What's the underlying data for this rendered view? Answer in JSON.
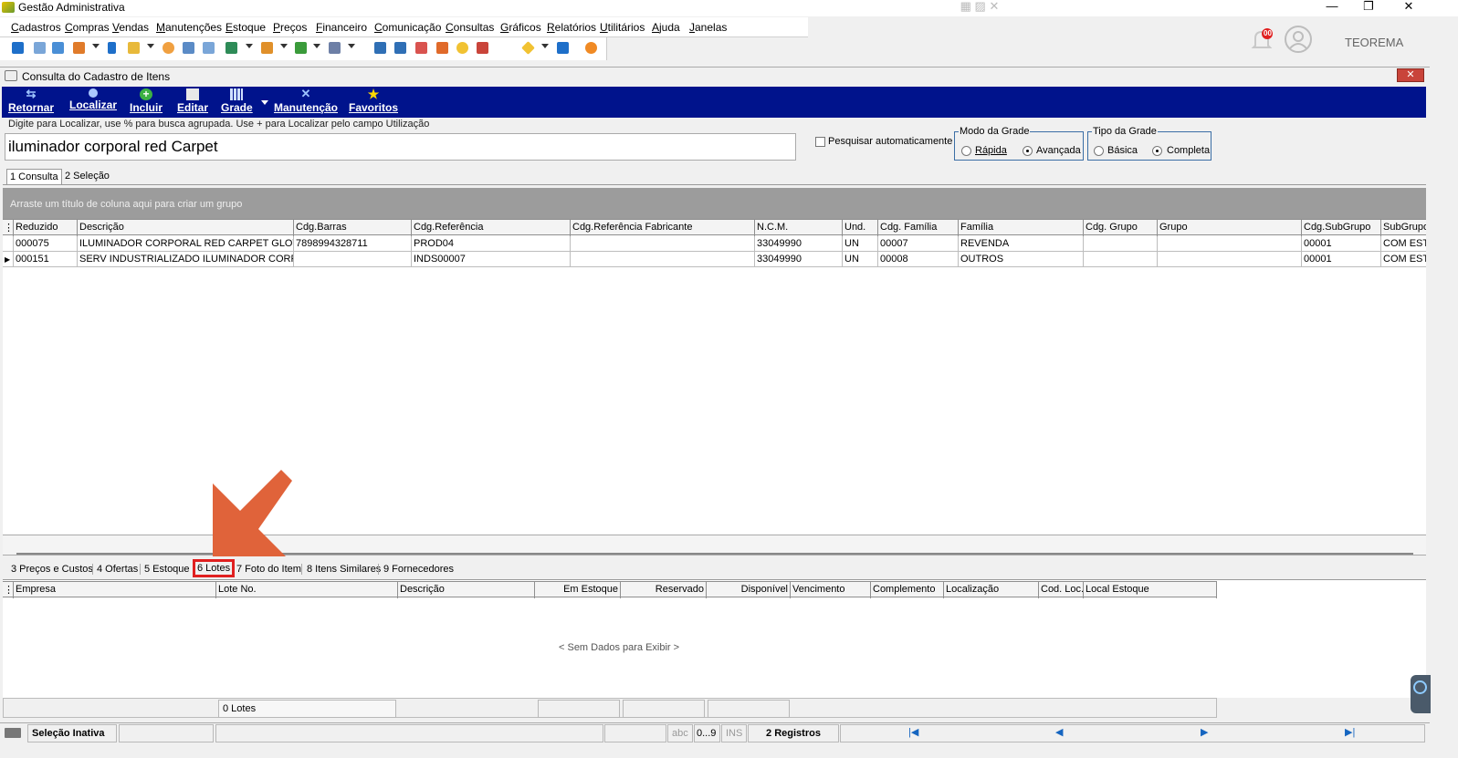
{
  "app": {
    "title": "Gestão Administrativa",
    "window_controls": [
      "—",
      "❐",
      "✕"
    ]
  },
  "menu": [
    "Cadastros",
    "Compras",
    "Vendas",
    "Manutenções",
    "Estoque",
    "Preços",
    "Financeiro",
    "Comunicação",
    "Consultas",
    "Gráficos",
    "Relatórios",
    "Utilitários",
    "Ajuda",
    "Janelas"
  ],
  "header_right": {
    "notification_count": "00",
    "user_name": "TEOREMA"
  },
  "window": {
    "title": "Consulta do Cadastro de Itens",
    "close": "✕",
    "actions": [
      "Retornar",
      "Localizar",
      "Incluir",
      "Editar",
      "Grade",
      "Manutenção",
      "Favoritos"
    ]
  },
  "search": {
    "hint": "Digite para Localizar, use % para busca agrupada. Use + para Localizar pelo campo Utilização",
    "value": "iluminador corporal red Carpet",
    "auto_search_label": "Pesquisar automaticamente"
  },
  "modo_grade": {
    "title": "Modo da Grade",
    "options": [
      "Rápida",
      "Avançada"
    ],
    "selected": "Avançada"
  },
  "tipo_grade": {
    "title": "Tipo da Grade",
    "options": [
      "Básica",
      "Completa"
    ],
    "selected": "Completa"
  },
  "top_tabs": [
    "1 Consulta",
    "2 Seleção"
  ],
  "group_hint": "Arraste um título de coluna aqui para criar um grupo",
  "items_grid": {
    "columns": [
      "Reduzido",
      "Descrição",
      "Cdg.Barras",
      "Cdg.Referência",
      "Cdg.Referência Fabricante",
      "N.C.M.",
      "Und.",
      "Cdg. Família",
      "Família",
      "Cdg. Grupo",
      "Grupo",
      "Cdg.SubGrupo",
      "SubGrupo"
    ],
    "rows": [
      [
        "000075",
        "ILUMINADOR CORPORAL RED CARPET GLOW",
        "7898994328711",
        "PROD04",
        "",
        "33049990",
        "UN",
        "00007",
        "REVENDA",
        "",
        "",
        "00001",
        "COM EST"
      ],
      [
        "000151",
        "SERV INDUSTRIALIZADO ILUMINADOR CORPORAL",
        "",
        "INDS00007",
        "",
        "33049990",
        "UN",
        "00008",
        "OUTROS",
        "",
        "",
        "00001",
        "COM EST"
      ]
    ]
  },
  "bottom_tabs": [
    "3 Preços e Custos",
    "4 Ofertas",
    "5 Estoque",
    "6 Lotes",
    "7 Foto do Item",
    "8 Itens Similares",
    "9 Fornecedores"
  ],
  "bottom_tabs_highlighted": "6 Lotes",
  "lotes_grid": {
    "columns": [
      "Empresa",
      "Lote No.",
      "Descrição",
      "Em Estoque",
      "Reservado",
      "Disponível",
      "Vencimento",
      "Complemento",
      "Localização",
      "Cod. Loc.",
      "Local Estoque"
    ],
    "empty_text": "< Sem Dados para Exibir >",
    "footer_count": "0 Lotes"
  },
  "status_bar": {
    "selection": "Seleção Inativa",
    "abc": "abc",
    "digits": "0...9",
    "ins": "INS",
    "records": "2 Registros",
    "nav": [
      "|◀",
      "◀",
      "▶",
      "▶|"
    ]
  },
  "colors": {
    "action_bar": "#00138c",
    "highlight": "#e02020",
    "arrow": "#e0633a"
  }
}
